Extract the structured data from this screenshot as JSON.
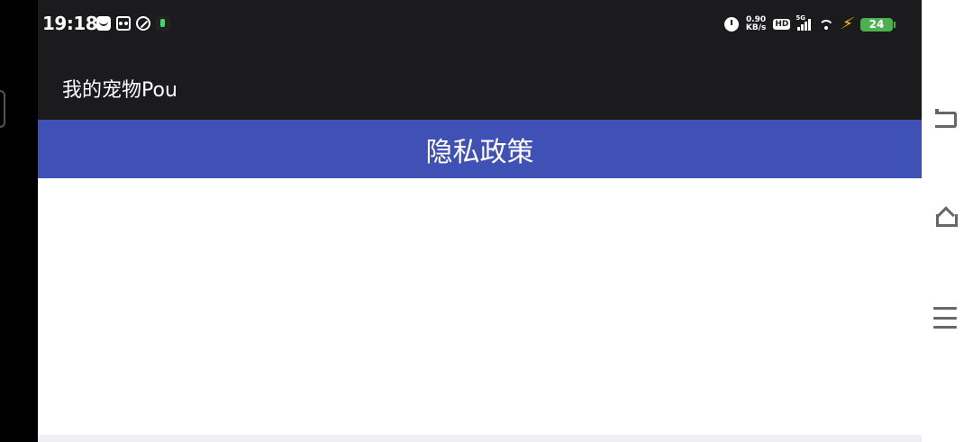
{
  "status_bar": {
    "time": "19:18",
    "left_icons": [
      "message-icon",
      "camera-app-icon",
      "leaf-app-icon",
      "green-app-icon"
    ],
    "net_speed_value": "0.90",
    "net_speed_unit": "KB/s",
    "hd_label": "HD",
    "network_label": "5G",
    "battery_level": "24",
    "colors": {
      "background": "#1b1b1d",
      "battery": "#4caf50",
      "charging": "#f5c400"
    }
  },
  "app_bar": {
    "title": "我的宠物Pou"
  },
  "header": {
    "title": "隐私政策",
    "color": "#3f51b5"
  },
  "nav_bar": {
    "buttons": [
      "back-icon",
      "home-icon",
      "menu-icon"
    ]
  }
}
